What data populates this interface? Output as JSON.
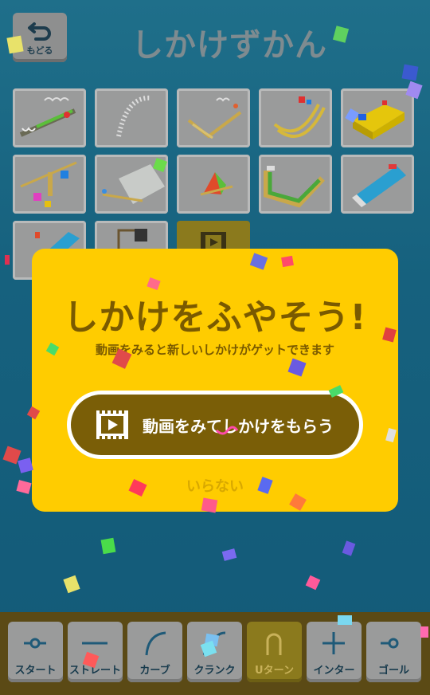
{
  "header": {
    "back_label": "もどる",
    "title": "しかけずかん"
  },
  "grid": {
    "tiles": [
      {
        "name": "slope-coil",
        "locked": false
      },
      {
        "name": "spiral-spring",
        "locked": false
      },
      {
        "name": "lever-rails",
        "locked": false
      },
      {
        "name": "curved-rails",
        "locked": false
      },
      {
        "name": "yellow-box",
        "locked": false
      },
      {
        "name": "pulley-blocks",
        "locked": false
      },
      {
        "name": "seesaw-board",
        "locked": false
      },
      {
        "name": "triangle-flag",
        "locked": false
      },
      {
        "name": "green-u-track",
        "locked": false
      },
      {
        "name": "eraser-ramp",
        "locked": false
      },
      {
        "name": "blue-ramp",
        "locked": false
      },
      {
        "name": "crane-block",
        "locked": false
      },
      {
        "name": "video-tile",
        "locked": true
      }
    ]
  },
  "dialog": {
    "title": "しかけをふやそう!",
    "subtitle": "動画をみると新しいしかけがゲットできます",
    "watch_button": "動画をみてしかけをもらう",
    "skip_label": "いらない"
  },
  "toolbar": {
    "items": [
      {
        "label": "スタート",
        "icon": "start-icon",
        "active": false
      },
      {
        "label": "ストレート",
        "icon": "straight-icon",
        "active": false
      },
      {
        "label": "カーブ",
        "icon": "curve-icon",
        "active": false
      },
      {
        "label": "クランク",
        "icon": "crank-icon",
        "active": false
      },
      {
        "label": "Uターン",
        "icon": "u-turn-icon",
        "active": true
      },
      {
        "label": "インター",
        "icon": "inter-icon",
        "active": false
      },
      {
        "label": "ゴール",
        "icon": "goal-icon",
        "active": false
      }
    ]
  },
  "colors": {
    "background": "#16617e",
    "dialog": "#ffcc00",
    "dialog_text": "#7a5a00",
    "button": "#7a5e07",
    "toolbar": "#5b4a15"
  }
}
